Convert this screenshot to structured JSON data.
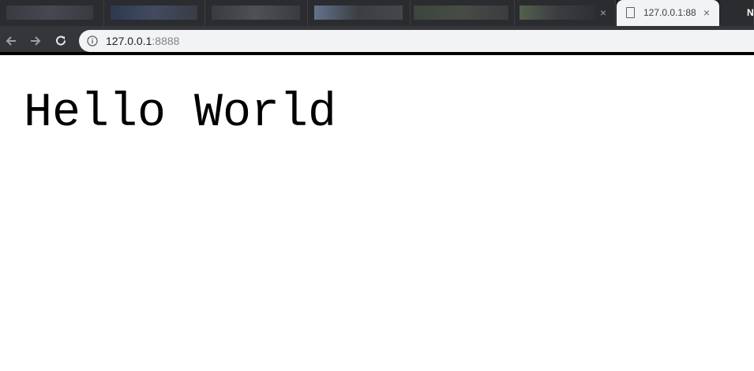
{
  "browser": {
    "tabs": [
      {
        "label": "",
        "blurred": true
      },
      {
        "label": "",
        "blurred": true
      },
      {
        "label": "",
        "blurred": true
      },
      {
        "label": "",
        "blurred": true
      },
      {
        "label": "",
        "blurred": true
      },
      {
        "label": "",
        "blurred": true,
        "close": "×"
      },
      {
        "label": "127.0.0.1:88",
        "active": true,
        "close": "×"
      },
      {
        "label": "N",
        "blurred": false
      }
    ],
    "address_bar": {
      "host": "127.0.0.1",
      "port": ":8888"
    },
    "colors": {
      "tabstrip": "#202124",
      "toolbar": "#35363a",
      "omnibox": "#f1f3f4"
    }
  },
  "page": {
    "heading": "Hello World"
  }
}
